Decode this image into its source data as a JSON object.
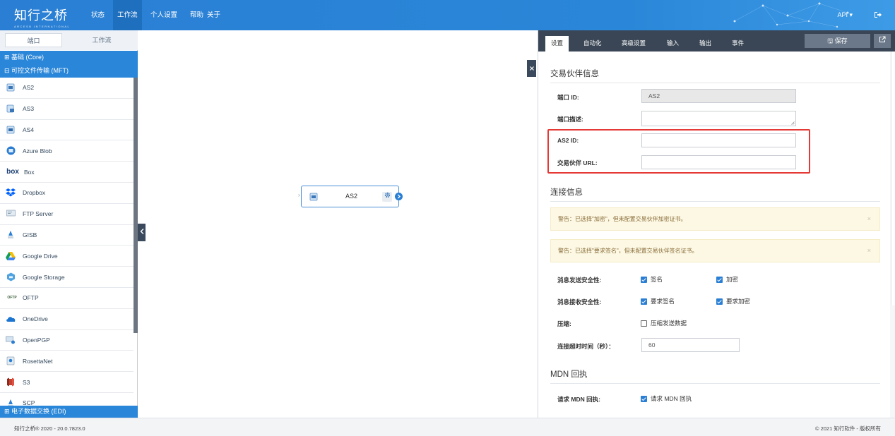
{
  "app": {
    "logo": "知行之桥",
    "logo_sub": "ARCESB INTERNATIONAL",
    "nav": [
      "状态",
      "工作流",
      "个人设置",
      "帮助",
      "关于"
    ],
    "api_menu": "API ▾"
  },
  "palette": {
    "tabs": [
      "端口",
      "工作流"
    ],
    "categories": [
      "⊞ 基础 (Core)",
      "⊟ 可控文件传输 (MFT)",
      "⊞ 电子数据交换 (EDI)"
    ],
    "items": [
      "AS2",
      "AS3",
      "AS4",
      "Azure Blob",
      "Box",
      "Dropbox",
      "FTP Server",
      "GISB",
      "Google Drive",
      "Google Storage",
      "OFTP",
      "OneDrive",
      "OpenPGP",
      "RosettaNet",
      "S3",
      "SCP"
    ],
    "icon_labels": {
      "box": "box",
      "oftp": "OFTP"
    }
  },
  "canvas": {
    "node_label": "AS2"
  },
  "settings": {
    "tabs": [
      "设置",
      "自动化",
      "高级设置",
      "输入",
      "输出",
      "事件"
    ],
    "save_label": "🖫 保存",
    "partner_section": "交易伙伴信息",
    "fields": {
      "port_id_label": "端口 ID:",
      "port_id_value": "AS2",
      "port_desc_label": "端口描述:",
      "as2_id_label": "AS2 ID:",
      "partner_url_label": "交易伙伴 URL:"
    },
    "connection_section": "连接信息",
    "alerts": [
      "警告：已选择\"加密\"，但未配置交易伙伴加密证书。",
      "警告：已选择\"要求签名\"，但未配置交易伙伴签名证书。"
    ],
    "alert_close": "×",
    "send_security_label": "消息发送安全性:",
    "send_sign": "签名",
    "send_encrypt": "加密",
    "recv_security_label": "消息接收安全性:",
    "recv_sign": "要求签名",
    "recv_encrypt": "要求加密",
    "compress_label": "压缩:",
    "compress_option": "压缩发送数据",
    "timeout_label": "连接超时时间（秒）：",
    "timeout_value": "60",
    "mdn_section": "MDN 回执",
    "mdn_label": "请求 MDN 回执:",
    "mdn_option": "请求 MDN 回执",
    "checks": {
      "send_sign": true,
      "send_encrypt": true,
      "recv_sign": true,
      "recv_encrypt": true,
      "compress": false,
      "mdn": true
    }
  },
  "footer": {
    "left": "知行之桥® 2020 - 20.0.7823.0",
    "right": "© 2021 知行软件 - 版权所有"
  },
  "colors": {
    "primary": "#2a86d8",
    "dark": "#3a4655",
    "alert_bg": "#fcf8e3",
    "highlight": "#e53935"
  }
}
